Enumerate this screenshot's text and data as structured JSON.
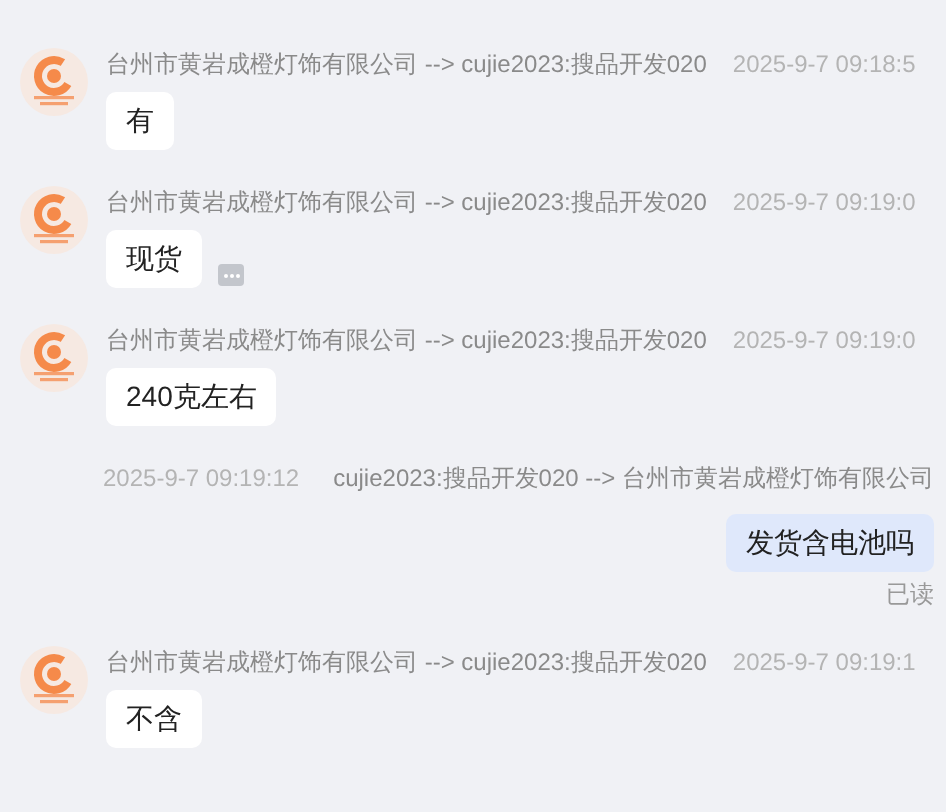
{
  "messages": [
    {
      "kind": "incoming",
      "route": "台州市黄岩成橙灯饰有限公司 --> cujie2023:搜品开发020",
      "time": "2025-9-7 09:18:5",
      "text": "有",
      "more": false
    },
    {
      "kind": "incoming",
      "route": "台州市黄岩成橙灯饰有限公司 --> cujie2023:搜品开发020",
      "time": "2025-9-7 09:19:0",
      "text": "现货",
      "more": true
    },
    {
      "kind": "incoming",
      "route": "台州市黄岩成橙灯饰有限公司 --> cujie2023:搜品开发020",
      "time": "2025-9-7 09:19:0",
      "text": "240克左右",
      "more": false
    },
    {
      "kind": "outgoing",
      "route": "cujie2023:搜品开发020 --> 台州市黄岩成橙灯饰有限公司",
      "time": "2025-9-7 09:19:12",
      "text": "发货含电池吗",
      "status": "已读"
    },
    {
      "kind": "incoming",
      "route": "台州市黄岩成橙灯饰有限公司 --> cujie2023:搜品开发020",
      "time": "2025-9-7 09:19:1",
      "text": "不含",
      "more": false
    }
  ]
}
